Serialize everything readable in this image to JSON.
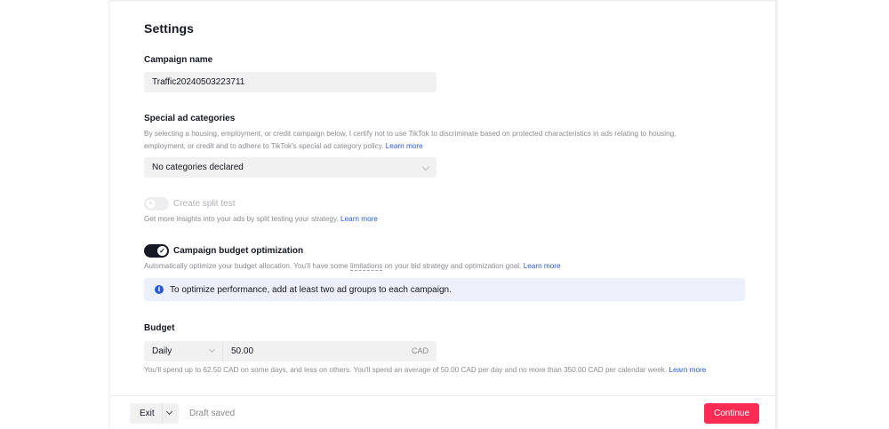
{
  "settings": {
    "title": "Settings"
  },
  "campaign_name": {
    "label": "Campaign name",
    "value": "Traffic20240503223711"
  },
  "special_ad": {
    "label": "Special ad categories",
    "description_line1": "By selecting a housing, employment, or credit campaign below, I certify not to use TikTok to discriminate based on protected characteristics in ads relating to housing,",
    "description_line2": "employment, or credit and to adhere to TikTok's special ad category policy.",
    "learn_more": "Learn more",
    "selected": "No categories declared"
  },
  "split_test": {
    "label": "Create split test",
    "enabled": false,
    "description": "Get more insights into your ads by split testing your strategy.",
    "learn_more": "Learn more"
  },
  "cbo": {
    "label": "Campaign budget optimization",
    "enabled": true,
    "description_pre": "Automatically optimize your budget allocation. You'll have some",
    "description_link": "limitations",
    "description_post": "on your bid strategy and optimization goal.",
    "learn_more": "Learn more"
  },
  "info": {
    "icon": "info-icon",
    "text": "To optimize performance, add at least two ad groups to each campaign."
  },
  "budget": {
    "label": "Budget",
    "frequency": "Daily",
    "amount": "50.00",
    "currency": "CAD",
    "note": "You'll spend up to 62.50 CAD on some days, and less on others. You'll spend an average of 50.00 CAD per day and no more than 350.00 CAD per calendar week.",
    "learn_more": "Learn more"
  },
  "footer": {
    "exit_label": "Exit",
    "draft_status": "Draft saved",
    "continue_label": "Continue"
  },
  "colors": {
    "accent": "#fe2c55",
    "link": "#2a59d6",
    "info_bg": "#ebf0fb"
  }
}
